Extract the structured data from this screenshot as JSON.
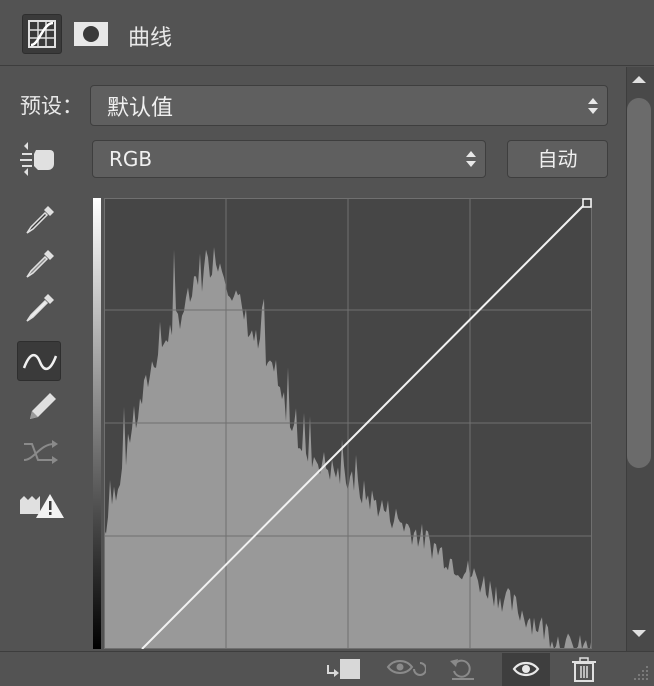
{
  "header": {
    "title": "曲线",
    "curves_icon": "curves-adjustment-icon",
    "mask_icon": "layer-mask-icon"
  },
  "preset": {
    "label": "预设：",
    "value": "默认值"
  },
  "channel": {
    "value": "RGB"
  },
  "auto_button": {
    "label": "自动"
  },
  "tools": [
    {
      "name": "on-image-adjust-hand-icon",
      "active": false
    },
    {
      "name": "black-point-eyedropper-icon",
      "active": false
    },
    {
      "name": "gray-point-eyedropper-icon",
      "active": false
    },
    {
      "name": "white-point-eyedropper-icon",
      "active": false
    },
    {
      "name": "edit-points-curve-icon",
      "active": true
    },
    {
      "name": "draw-pencil-icon",
      "active": false
    },
    {
      "name": "smooth-curve-icon",
      "active": false
    },
    {
      "name": "clipping-warning-icon",
      "active": false
    }
  ],
  "footer": {
    "icons": [
      "clip-to-layer-icon",
      "view-previous-state-icon",
      "reset-icon",
      "toggle-visibility-eye-icon",
      "delete-trash-icon"
    ]
  },
  "colors": {
    "panel_bg": "#535353",
    "graph_bg": "#464646",
    "histogram": "#999999",
    "grid": "#6e6e6e",
    "curve": "#f2f2f2"
  }
}
